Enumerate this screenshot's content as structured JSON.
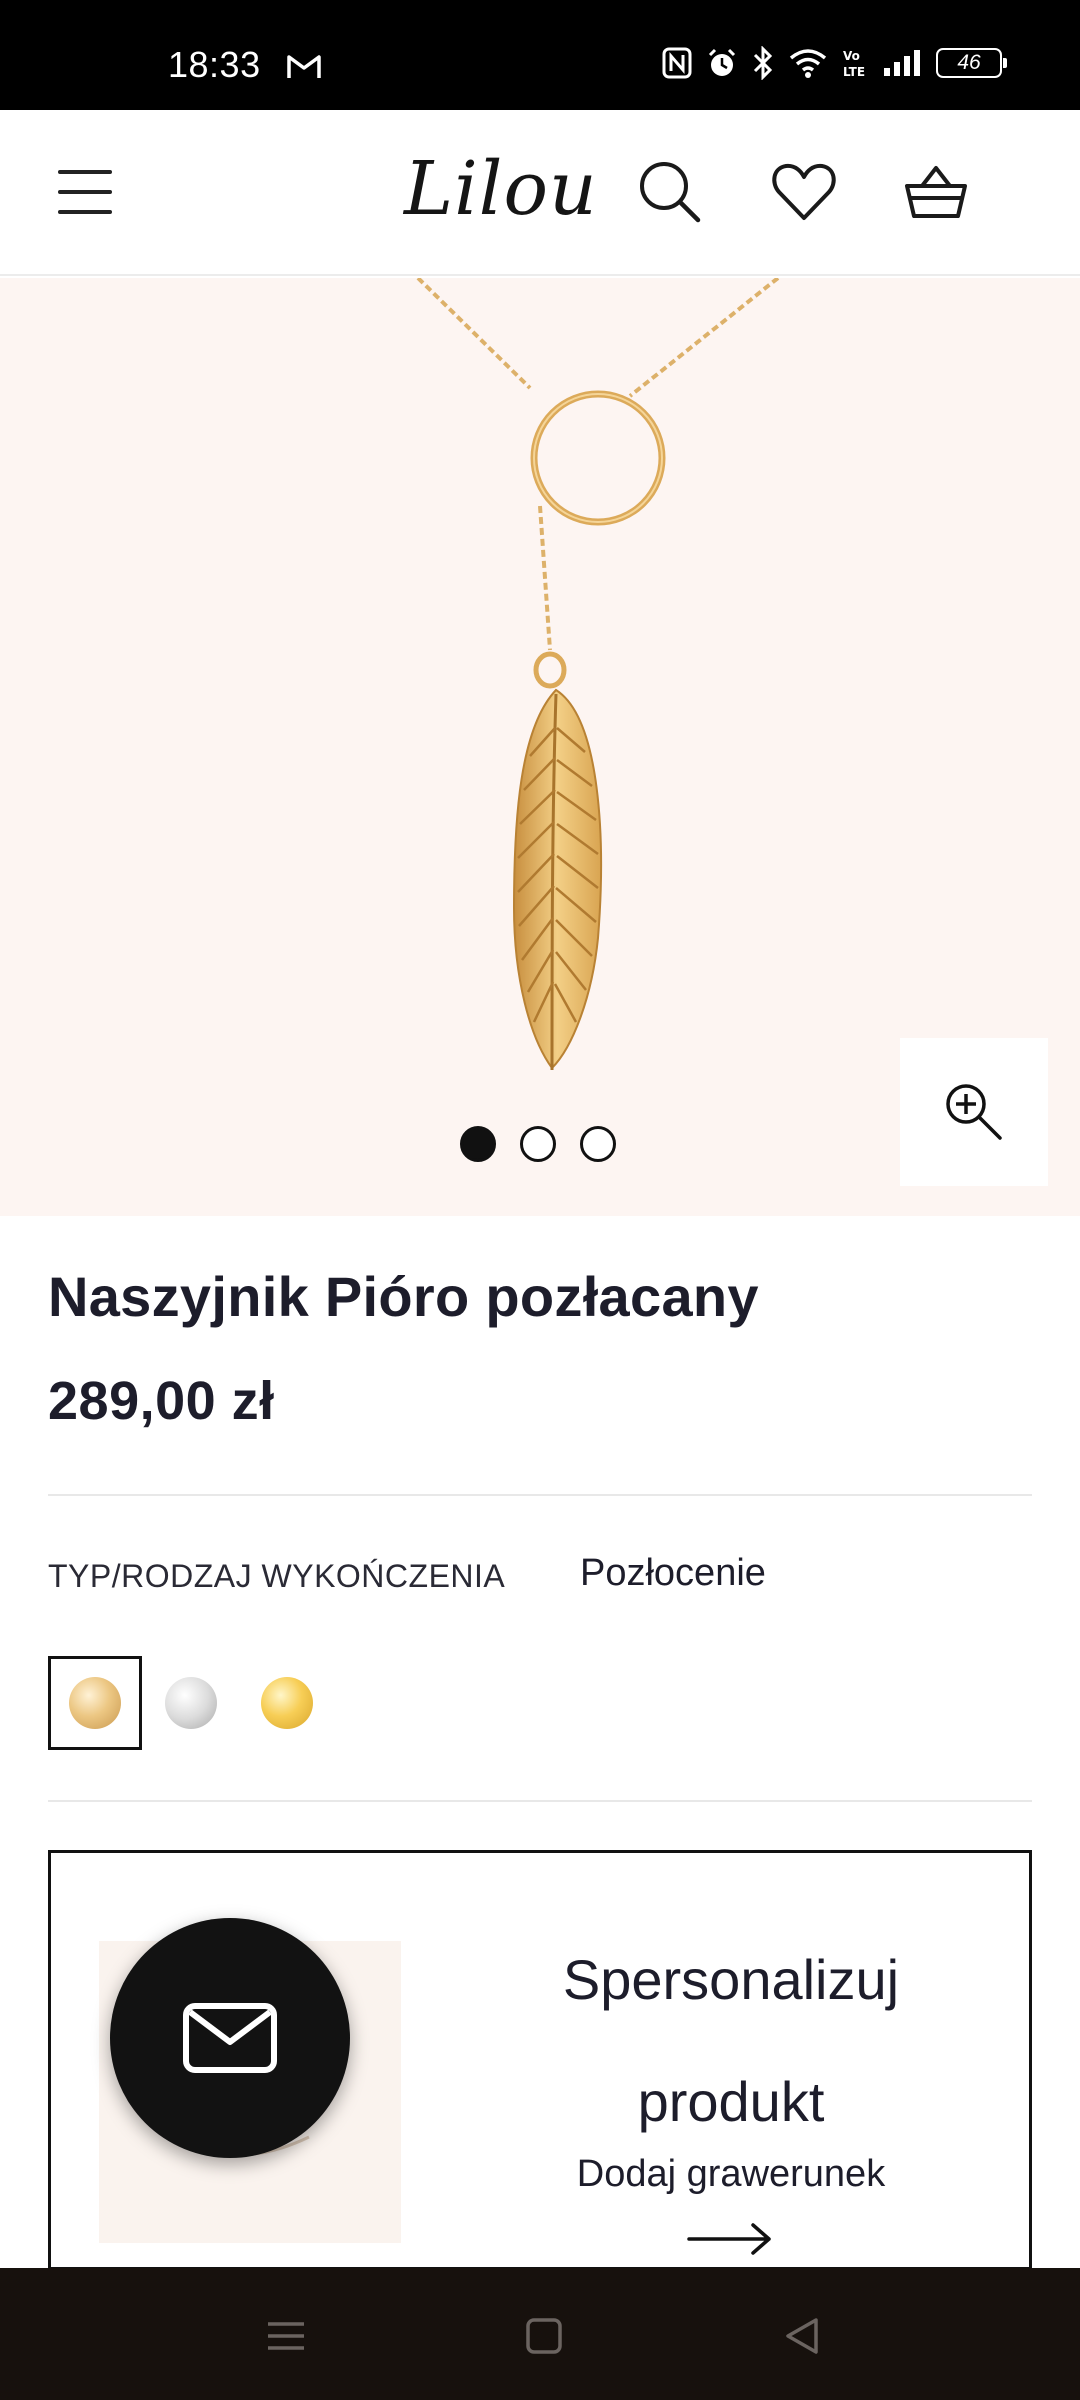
{
  "status_bar": {
    "time": "18:33",
    "battery": "46",
    "icons": [
      "gmail-icon",
      "nfc-icon",
      "alarm-icon",
      "bluetooth-icon",
      "wifi-icon",
      "volte-icon",
      "signal-icon",
      "battery-icon"
    ]
  },
  "header": {
    "logo": "Lilou",
    "icons": [
      "menu-icon",
      "search-icon",
      "heart-icon",
      "basket-icon"
    ]
  },
  "gallery": {
    "slides": 3,
    "active_slide": 1,
    "zoom_icon": "zoom-in-icon"
  },
  "product": {
    "title": "Naszyjnik Pióro pozłacany",
    "price": "289,00 zł",
    "option_label": "TYP/RODZAJ WYKOŃCZENIA",
    "option_value": "Pozłocenie",
    "swatches": [
      {
        "name": "rose-gold",
        "color": "#e9c07d",
        "selected": true
      },
      {
        "name": "silver",
        "color": "#d6d6d6",
        "selected": false
      },
      {
        "name": "gold",
        "color": "#f4c84c",
        "selected": false
      }
    ]
  },
  "personalize": {
    "title": "Spersonalizuj produkt",
    "subtitle": "Dodaj grawerunek"
  },
  "chat": {
    "icon": "envelope-icon"
  },
  "colors": {
    "status_bg": "#000000",
    "gallery_bg": "#fdf5f2",
    "jewelry_gold": "#e2b45f",
    "text_dark": "#1d1d2b",
    "nav_bg": "#17110d"
  }
}
